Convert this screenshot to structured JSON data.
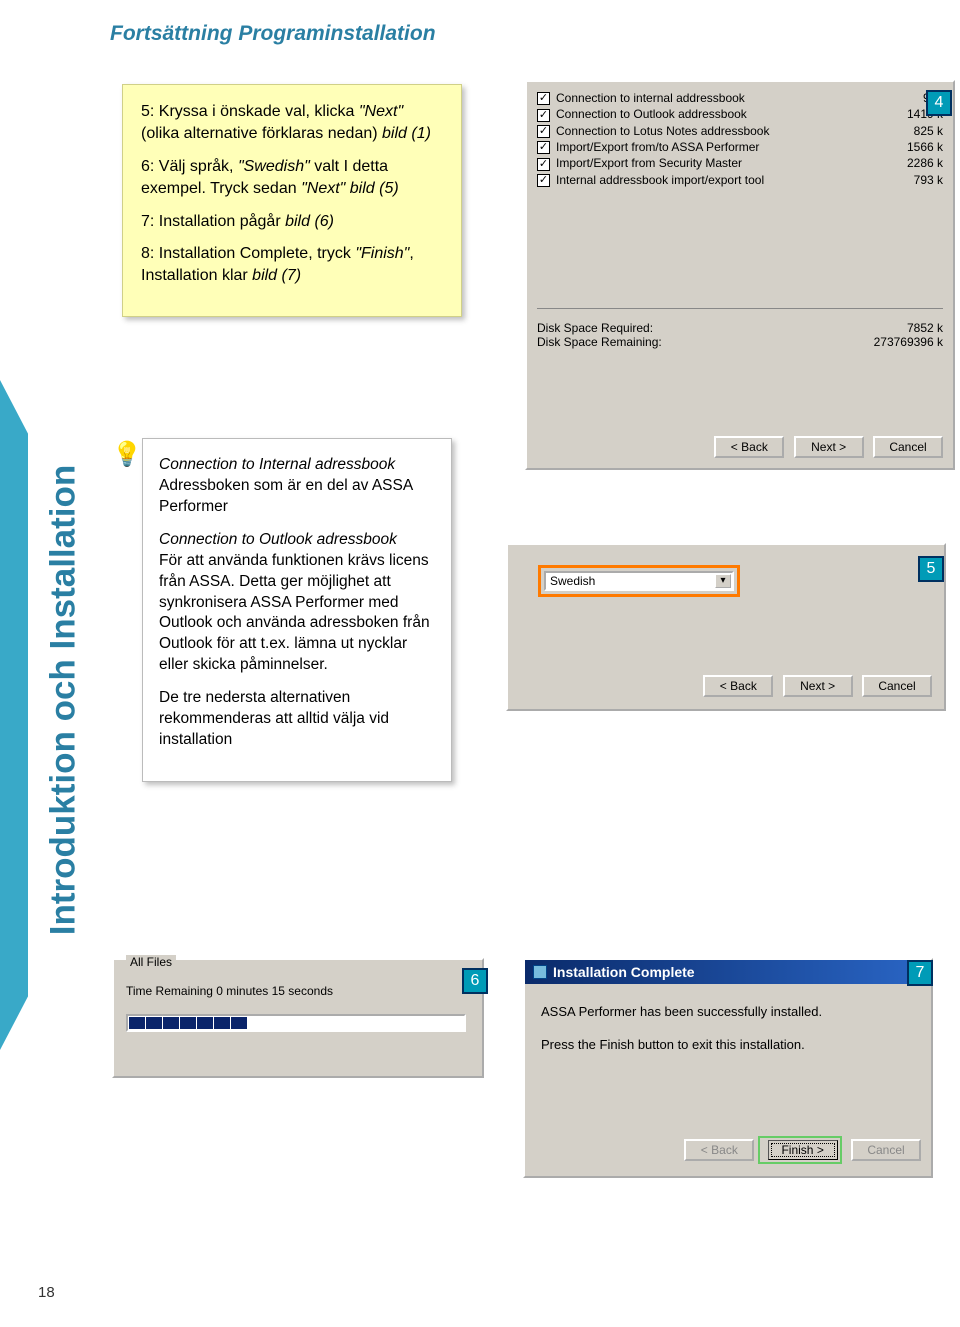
{
  "page": {
    "title": "Fortsättning Programinstallation",
    "sidebar_label": "Introduktion och Installation",
    "page_number": "18"
  },
  "note": {
    "p1a": "5: Kryssa i önskade val, klicka ",
    "p1b": "\"Next\"",
    "p1c": " (olika alternative förklaras nedan) ",
    "p1d": "bild (1)",
    "p2a": "6: Välj språk, ",
    "p2b": "\"Swedish\"",
    "p2c": " valt I detta exempel. Tryck sedan ",
    "p2d": "\"Next\" bild (5)",
    "p3a": "7: Installation pågår ",
    "p3b": "bild (6)",
    "p4a": "8: Installation Complete, tryck ",
    "p4b": "\"Finish\"",
    "p4c": ", Installation klar ",
    "p4d": "bild (7)"
  },
  "tips": {
    "h1": "Connection to Internal adressbook",
    "t1": "Adressboken som är en del av ASSA Performer",
    "h2": "Connection to Outlook adressbook",
    "t2": "För att använda funktionen krävs licens från ASSA. Detta ger möjlighet att synkronisera ASSA Performer med Outlook och använda adressboken från Outlook för att t.ex. lämna ut nycklar eller skicka påminnelser.",
    "t3": "De tre nedersta alternativen rekommenderas att alltid välja vid installation"
  },
  "callouts": {
    "c4": "4",
    "c5": "5",
    "c6": "6",
    "c7": "7"
  },
  "dlg4": {
    "items": [
      {
        "label": "Connection to internal addressbook",
        "size": "963"
      },
      {
        "label": "Connection to  Outlook addressbook",
        "size": "1419 k"
      },
      {
        "label": "Connection to Lotus Notes addressbook",
        "size": "825 k"
      },
      {
        "label": "Import/Export from/to ASSA Performer",
        "size": "1566 k"
      },
      {
        "label": "Import/Export from Security Master",
        "size": "2286 k"
      },
      {
        "label": "Internal addressbook import/export tool",
        "size": "793 k"
      }
    ],
    "disk_req_label": "Disk Space Required:",
    "disk_req_val": "7852 k",
    "disk_rem_label": "Disk Space Remaining:",
    "disk_rem_val": "273769396 k",
    "back": "< Back",
    "next": "Next >",
    "cancel": "Cancel"
  },
  "dlg5": {
    "language": "Swedish",
    "back": "< Back",
    "next": "Next >",
    "cancel": "Cancel"
  },
  "dlg6": {
    "header": "All Files",
    "time": "Time Remaining 0 minutes 15 seconds"
  },
  "dlg7": {
    "title": "Installation Complete",
    "msg1": "ASSA Performer has been successfully installed.",
    "msg2": "Press the Finish button to exit this installation.",
    "back": "< Back",
    "finish": "Finish >",
    "cancel": "Cancel"
  }
}
